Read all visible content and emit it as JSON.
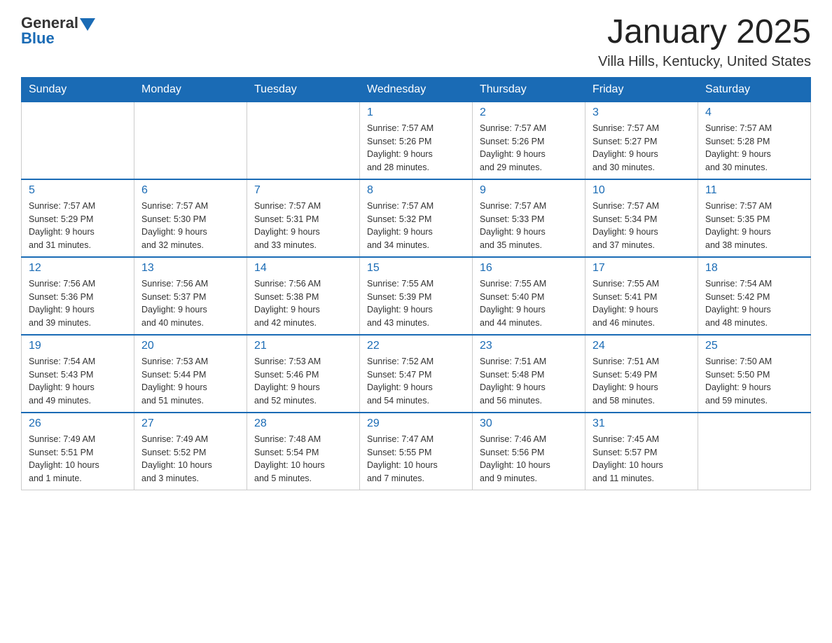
{
  "header": {
    "logo_general": "General",
    "logo_blue": "Blue",
    "month_title": "January 2025",
    "location": "Villa Hills, Kentucky, United States"
  },
  "days_of_week": [
    "Sunday",
    "Monday",
    "Tuesday",
    "Wednesday",
    "Thursday",
    "Friday",
    "Saturday"
  ],
  "weeks": [
    [
      {
        "day": "",
        "info": ""
      },
      {
        "day": "",
        "info": ""
      },
      {
        "day": "",
        "info": ""
      },
      {
        "day": "1",
        "info": "Sunrise: 7:57 AM\nSunset: 5:26 PM\nDaylight: 9 hours\nand 28 minutes."
      },
      {
        "day": "2",
        "info": "Sunrise: 7:57 AM\nSunset: 5:26 PM\nDaylight: 9 hours\nand 29 minutes."
      },
      {
        "day": "3",
        "info": "Sunrise: 7:57 AM\nSunset: 5:27 PM\nDaylight: 9 hours\nand 30 minutes."
      },
      {
        "day": "4",
        "info": "Sunrise: 7:57 AM\nSunset: 5:28 PM\nDaylight: 9 hours\nand 30 minutes."
      }
    ],
    [
      {
        "day": "5",
        "info": "Sunrise: 7:57 AM\nSunset: 5:29 PM\nDaylight: 9 hours\nand 31 minutes."
      },
      {
        "day": "6",
        "info": "Sunrise: 7:57 AM\nSunset: 5:30 PM\nDaylight: 9 hours\nand 32 minutes."
      },
      {
        "day": "7",
        "info": "Sunrise: 7:57 AM\nSunset: 5:31 PM\nDaylight: 9 hours\nand 33 minutes."
      },
      {
        "day": "8",
        "info": "Sunrise: 7:57 AM\nSunset: 5:32 PM\nDaylight: 9 hours\nand 34 minutes."
      },
      {
        "day": "9",
        "info": "Sunrise: 7:57 AM\nSunset: 5:33 PM\nDaylight: 9 hours\nand 35 minutes."
      },
      {
        "day": "10",
        "info": "Sunrise: 7:57 AM\nSunset: 5:34 PM\nDaylight: 9 hours\nand 37 minutes."
      },
      {
        "day": "11",
        "info": "Sunrise: 7:57 AM\nSunset: 5:35 PM\nDaylight: 9 hours\nand 38 minutes."
      }
    ],
    [
      {
        "day": "12",
        "info": "Sunrise: 7:56 AM\nSunset: 5:36 PM\nDaylight: 9 hours\nand 39 minutes."
      },
      {
        "day": "13",
        "info": "Sunrise: 7:56 AM\nSunset: 5:37 PM\nDaylight: 9 hours\nand 40 minutes."
      },
      {
        "day": "14",
        "info": "Sunrise: 7:56 AM\nSunset: 5:38 PM\nDaylight: 9 hours\nand 42 minutes."
      },
      {
        "day": "15",
        "info": "Sunrise: 7:55 AM\nSunset: 5:39 PM\nDaylight: 9 hours\nand 43 minutes."
      },
      {
        "day": "16",
        "info": "Sunrise: 7:55 AM\nSunset: 5:40 PM\nDaylight: 9 hours\nand 44 minutes."
      },
      {
        "day": "17",
        "info": "Sunrise: 7:55 AM\nSunset: 5:41 PM\nDaylight: 9 hours\nand 46 minutes."
      },
      {
        "day": "18",
        "info": "Sunrise: 7:54 AM\nSunset: 5:42 PM\nDaylight: 9 hours\nand 48 minutes."
      }
    ],
    [
      {
        "day": "19",
        "info": "Sunrise: 7:54 AM\nSunset: 5:43 PM\nDaylight: 9 hours\nand 49 minutes."
      },
      {
        "day": "20",
        "info": "Sunrise: 7:53 AM\nSunset: 5:44 PM\nDaylight: 9 hours\nand 51 minutes."
      },
      {
        "day": "21",
        "info": "Sunrise: 7:53 AM\nSunset: 5:46 PM\nDaylight: 9 hours\nand 52 minutes."
      },
      {
        "day": "22",
        "info": "Sunrise: 7:52 AM\nSunset: 5:47 PM\nDaylight: 9 hours\nand 54 minutes."
      },
      {
        "day": "23",
        "info": "Sunrise: 7:51 AM\nSunset: 5:48 PM\nDaylight: 9 hours\nand 56 minutes."
      },
      {
        "day": "24",
        "info": "Sunrise: 7:51 AM\nSunset: 5:49 PM\nDaylight: 9 hours\nand 58 minutes."
      },
      {
        "day": "25",
        "info": "Sunrise: 7:50 AM\nSunset: 5:50 PM\nDaylight: 9 hours\nand 59 minutes."
      }
    ],
    [
      {
        "day": "26",
        "info": "Sunrise: 7:49 AM\nSunset: 5:51 PM\nDaylight: 10 hours\nand 1 minute."
      },
      {
        "day": "27",
        "info": "Sunrise: 7:49 AM\nSunset: 5:52 PM\nDaylight: 10 hours\nand 3 minutes."
      },
      {
        "day": "28",
        "info": "Sunrise: 7:48 AM\nSunset: 5:54 PM\nDaylight: 10 hours\nand 5 minutes."
      },
      {
        "day": "29",
        "info": "Sunrise: 7:47 AM\nSunset: 5:55 PM\nDaylight: 10 hours\nand 7 minutes."
      },
      {
        "day": "30",
        "info": "Sunrise: 7:46 AM\nSunset: 5:56 PM\nDaylight: 10 hours\nand 9 minutes."
      },
      {
        "day": "31",
        "info": "Sunrise: 7:45 AM\nSunset: 5:57 PM\nDaylight: 10 hours\nand 11 minutes."
      },
      {
        "day": "",
        "info": ""
      }
    ]
  ]
}
